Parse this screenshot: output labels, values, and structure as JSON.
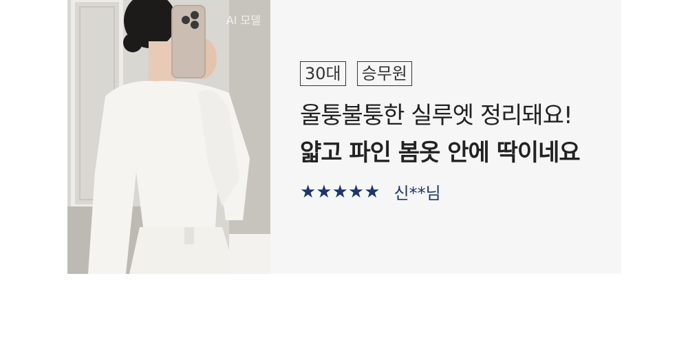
{
  "photo": {
    "ai_label": "AI 모델",
    "description_icon": "model-photo"
  },
  "review": {
    "tags": [
      "30대",
      "승무원"
    ],
    "line1": "울퉁불퉁한 실루엣 정리돼요!",
    "line2": "얇고 파인 봄옷 안에 딱이네요",
    "stars": "★★★★★",
    "rating": 5,
    "reviewer": "신**님"
  },
  "colors": {
    "card_bg": "#f6f6f6",
    "star": "#1c3670",
    "text": "#222222"
  }
}
